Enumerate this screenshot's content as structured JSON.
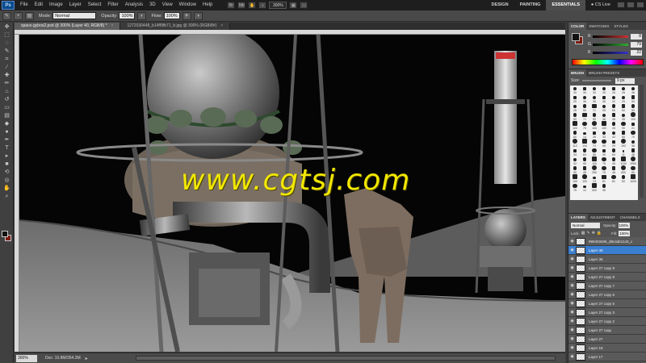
{
  "app": {
    "logo": "Ps"
  },
  "menu": [
    "File",
    "Edit",
    "Image",
    "Layer",
    "Select",
    "Filter",
    "Analysis",
    "3D",
    "View",
    "Window",
    "Help"
  ],
  "menu_zoom": "300%",
  "workspace": {
    "items": [
      "DESIGN",
      "PAINTING",
      "ESSENTIALS"
    ],
    "active": "ESSENTIALS"
  },
  "cslive": "CS Live",
  "options": {
    "mode_label": "Mode:",
    "mode_value": "Normal",
    "opacity_label": "Opacity:",
    "opacity_value": "100%",
    "flow_label": "Flow:",
    "flow_value": "100%"
  },
  "tabs": [
    {
      "label": "space-gybos2.psd @ 300% (Layer 40, RGB/8) *",
      "active": true
    },
    {
      "label": "1272030448_b14ff9fb71_b.jpg @ 300% (RGB/8#)",
      "active": false
    }
  ],
  "watermark": "www.cgtsj.com",
  "status": {
    "zoom": "300%",
    "doc": "Doc: 10.8M/354.3M"
  },
  "color_panel": {
    "tabs": [
      "COLOR",
      "SWATCHES",
      "STYLES"
    ],
    "channels": [
      {
        "ch": "R",
        "value": "8",
        "color": "#c33"
      },
      {
        "ch": "G",
        "value": "79",
        "color": "#3a3"
      },
      {
        "ch": "B",
        "value": "22",
        "color": "#33c"
      }
    ],
    "fg_color": "#111111",
    "bg_color": "#7a1b10"
  },
  "brush_panel": {
    "tabs": [
      "BRUSH",
      "BRUSH PRESETS"
    ],
    "size_label": "Size:",
    "size_value": "9 px",
    "sizes": [
      "30",
      "30",
      "30",
      "25",
      "25",
      "25",
      "36",
      "25",
      "36",
      "36",
      "36",
      "32",
      "25",
      "50",
      "25",
      "50",
      "71",
      "25",
      "50",
      "50",
      "50",
      "50",
      "71",
      "50",
      "36",
      "48",
      "35",
      "100",
      "100",
      "75",
      "106",
      "100",
      "45",
      "90",
      "21",
      "60",
      "14",
      "26",
      "33",
      "42",
      "55",
      "70",
      "112",
      "134",
      "74",
      "95",
      "29",
      "192",
      "36",
      "33",
      "63",
      "66",
      "39",
      "63",
      "11",
      "48",
      "32",
      "55",
      "100",
      "75",
      "45",
      "1150",
      "1950",
      "50",
      "45",
      "250",
      "75",
      "48",
      "900",
      "65",
      "100",
      "100",
      "13",
      "81",
      "81",
      "50",
      "1000",
      "75",
      "12",
      "300",
      "45"
    ]
  },
  "layers_panel": {
    "tabs": [
      "LAYERS",
      "ADJUSTMENT",
      "CHANNELS"
    ],
    "mode": "Normal",
    "opacity_label": "Opacity:",
    "opacity": "100%",
    "lock_label": "Lock:",
    "fill_label": "Fill:",
    "fill": "100%",
    "layers": [
      {
        "name": "990403406_d8c4ab1143_o",
        "selected": false
      },
      {
        "name": "Layer 40",
        "selected": true
      },
      {
        "name": "Layer 36",
        "selected": false
      },
      {
        "name": "Layer 27 copy 9",
        "selected": false
      },
      {
        "name": "Layer 27 copy 8",
        "selected": false
      },
      {
        "name": "Layer 27 copy 7",
        "selected": false
      },
      {
        "name": "Layer 27 copy 6",
        "selected": false
      },
      {
        "name": "Layer 27 copy 5",
        "selected": false
      },
      {
        "name": "Layer 27 copy 3",
        "selected": false
      },
      {
        "name": "Layer 27 copy 2",
        "selected": false
      },
      {
        "name": "Layer 27 copy",
        "selected": false
      },
      {
        "name": "Layer 27",
        "selected": false
      },
      {
        "name": "Layer 18",
        "selected": false
      },
      {
        "name": "Layer 17",
        "selected": false
      }
    ]
  }
}
